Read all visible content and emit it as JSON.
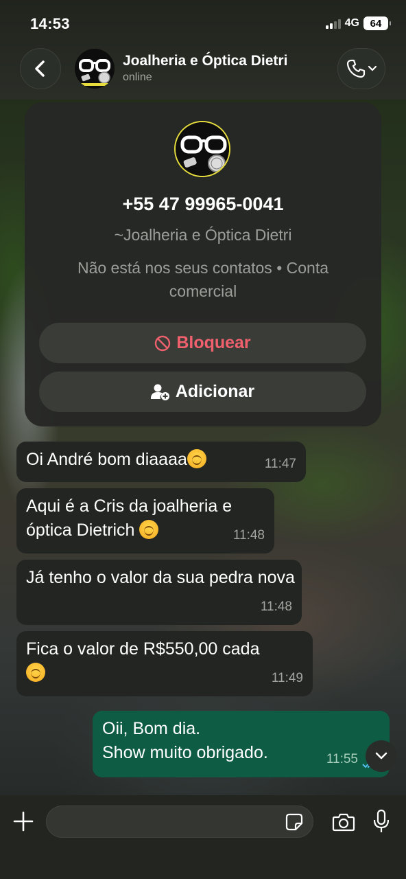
{
  "status_bar": {
    "time": "14:53",
    "network": "4G",
    "battery": "64"
  },
  "header": {
    "contact_name": "Joalheria e Óptica Dietri",
    "presence": "online",
    "avatar_icon": "eyeglasses-and-watch-logo",
    "back_icon": "chevron-left-icon",
    "call_icon": "phone-icon"
  },
  "contact_card": {
    "phone": "+55 47 99965-0041",
    "name": "~Joalheria e Óptica Dietri",
    "info": "Não está nos seus contatos • Conta comercial",
    "block_label": "Bloquear",
    "add_label": "Adicionar"
  },
  "messages": [
    {
      "direction": "in",
      "text": "Oi André bom diaaaa",
      "emoji": true,
      "time": "11:47"
    },
    {
      "direction": "in",
      "text": "Aqui é a Cris da joalheria e óptica Dietrich",
      "emoji": true,
      "time": "11:48"
    },
    {
      "direction": "in",
      "text": "Já tenho o valor da sua pedra nova",
      "emoji": false,
      "time": "11:48"
    },
    {
      "direction": "in",
      "text": "Fica o valor de R$550,00 cada",
      "emoji": true,
      "time": "11:49"
    },
    {
      "direction": "out",
      "line1": "Oii, Bom dia.",
      "line2": "Show muito obrigado.",
      "time": "11:55",
      "status": "read"
    }
  ],
  "composer": {
    "placeholder": ""
  },
  "colors": {
    "outgoing_bubble": "#0f5c44",
    "incoming_bubble": "#232522",
    "block_red": "#f0606d",
    "read_ticks": "#53bdeb"
  }
}
